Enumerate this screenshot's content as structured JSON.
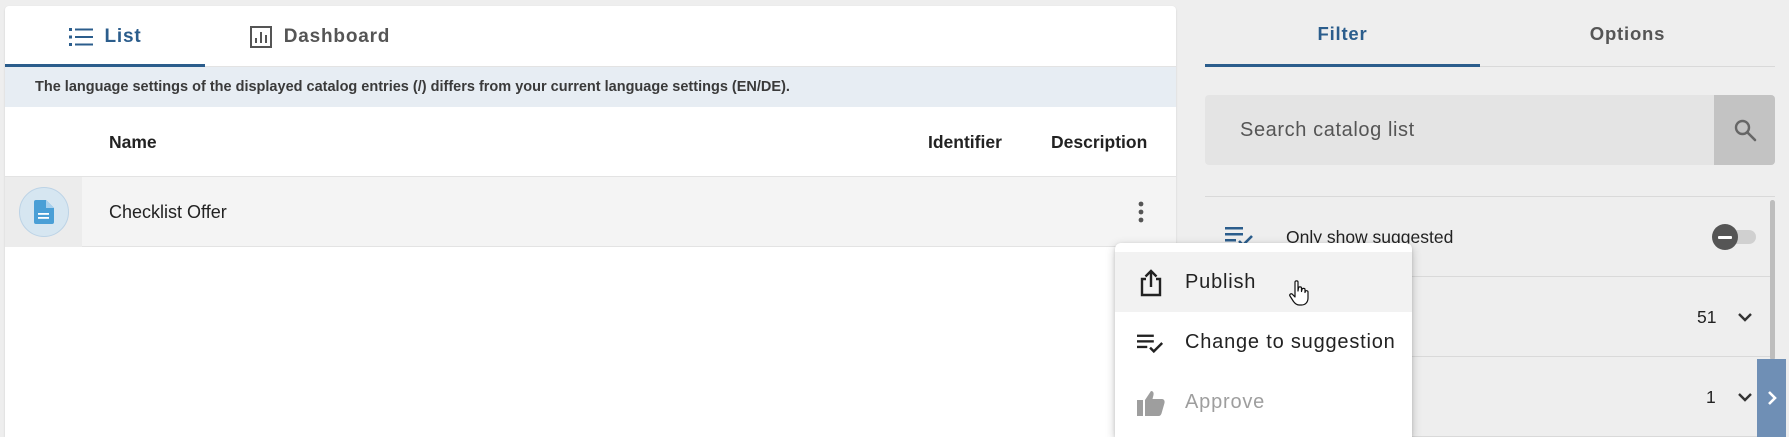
{
  "main_tabs": [
    {
      "label": "List",
      "icon": "list-icon",
      "active": true
    },
    {
      "label": "Dashboard",
      "icon": "dashboard-icon",
      "active": false
    }
  ],
  "notice": "The language settings of the displayed catalog entries (/) differs from your current language settings (EN/DE).",
  "table": {
    "columns": [
      "Name",
      "Identifier",
      "Description"
    ],
    "rows": [
      {
        "icon": "document-icon",
        "name": "Checklist Offer",
        "identifier": "",
        "description": ""
      }
    ]
  },
  "side_tabs": [
    {
      "label": "Filter",
      "active": true
    },
    {
      "label": "Options",
      "active": false
    }
  ],
  "search": {
    "placeholder": "Search catalog list",
    "value": ""
  },
  "filters": [
    {
      "label": "Only show suggested",
      "icon": "playlist-check-icon",
      "control": "toggle",
      "state": "off"
    },
    {
      "label": "",
      "count": "51",
      "control": "expand"
    },
    {
      "label": "",
      "count": "1",
      "control": "expand"
    }
  ],
  "context_menu": {
    "items": [
      {
        "label": "Publish",
        "icon": "share-upload-icon",
        "disabled": false,
        "hovered": true
      },
      {
        "label": "Change to suggestion",
        "icon": "playlist-check-icon",
        "disabled": false,
        "hovered": false
      },
      {
        "label": "Approve",
        "icon": "thumb-up-icon",
        "disabled": true,
        "hovered": false
      }
    ]
  },
  "colors": {
    "accent": "#2b5d8c",
    "notice_bg": "#e7edf3",
    "handle": "#6f8fb5",
    "doc_icon": "#4a9fd6",
    "disabled_text": "#9e9e9e"
  }
}
